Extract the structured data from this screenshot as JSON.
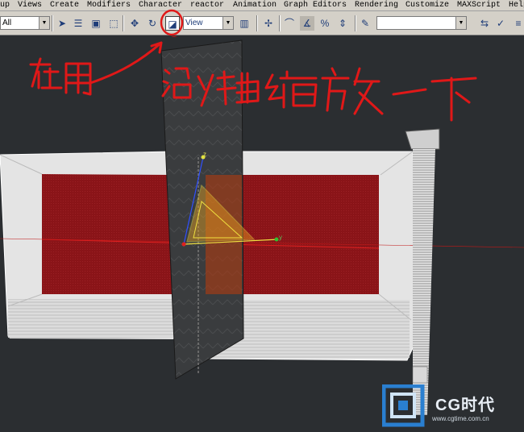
{
  "menu": {
    "items": [
      "up",
      "Views",
      "Create",
      "Modifiers",
      "Character",
      "reactor",
      "Animation",
      "Graph Editors",
      "Rendering",
      "Customize",
      "MAXScript",
      "Help"
    ]
  },
  "toolbar": {
    "selection_filter": "All",
    "reference_coord": "View",
    "named_selection": ""
  },
  "viewport": {
    "axis_y": "y",
    "axis_z": "z"
  },
  "annotation": {
    "text": "在用  沿y轴缩放一下",
    "color": "#e01818"
  },
  "watermark": {
    "brand": "CG时代",
    "url": "www.cgtime.com.cn"
  },
  "colors": {
    "ui_gray": "#d4d0c8",
    "viewport_bg": "#2b2e31",
    "panel_red": "#8a1418",
    "box_white": "#e8e8e8"
  }
}
